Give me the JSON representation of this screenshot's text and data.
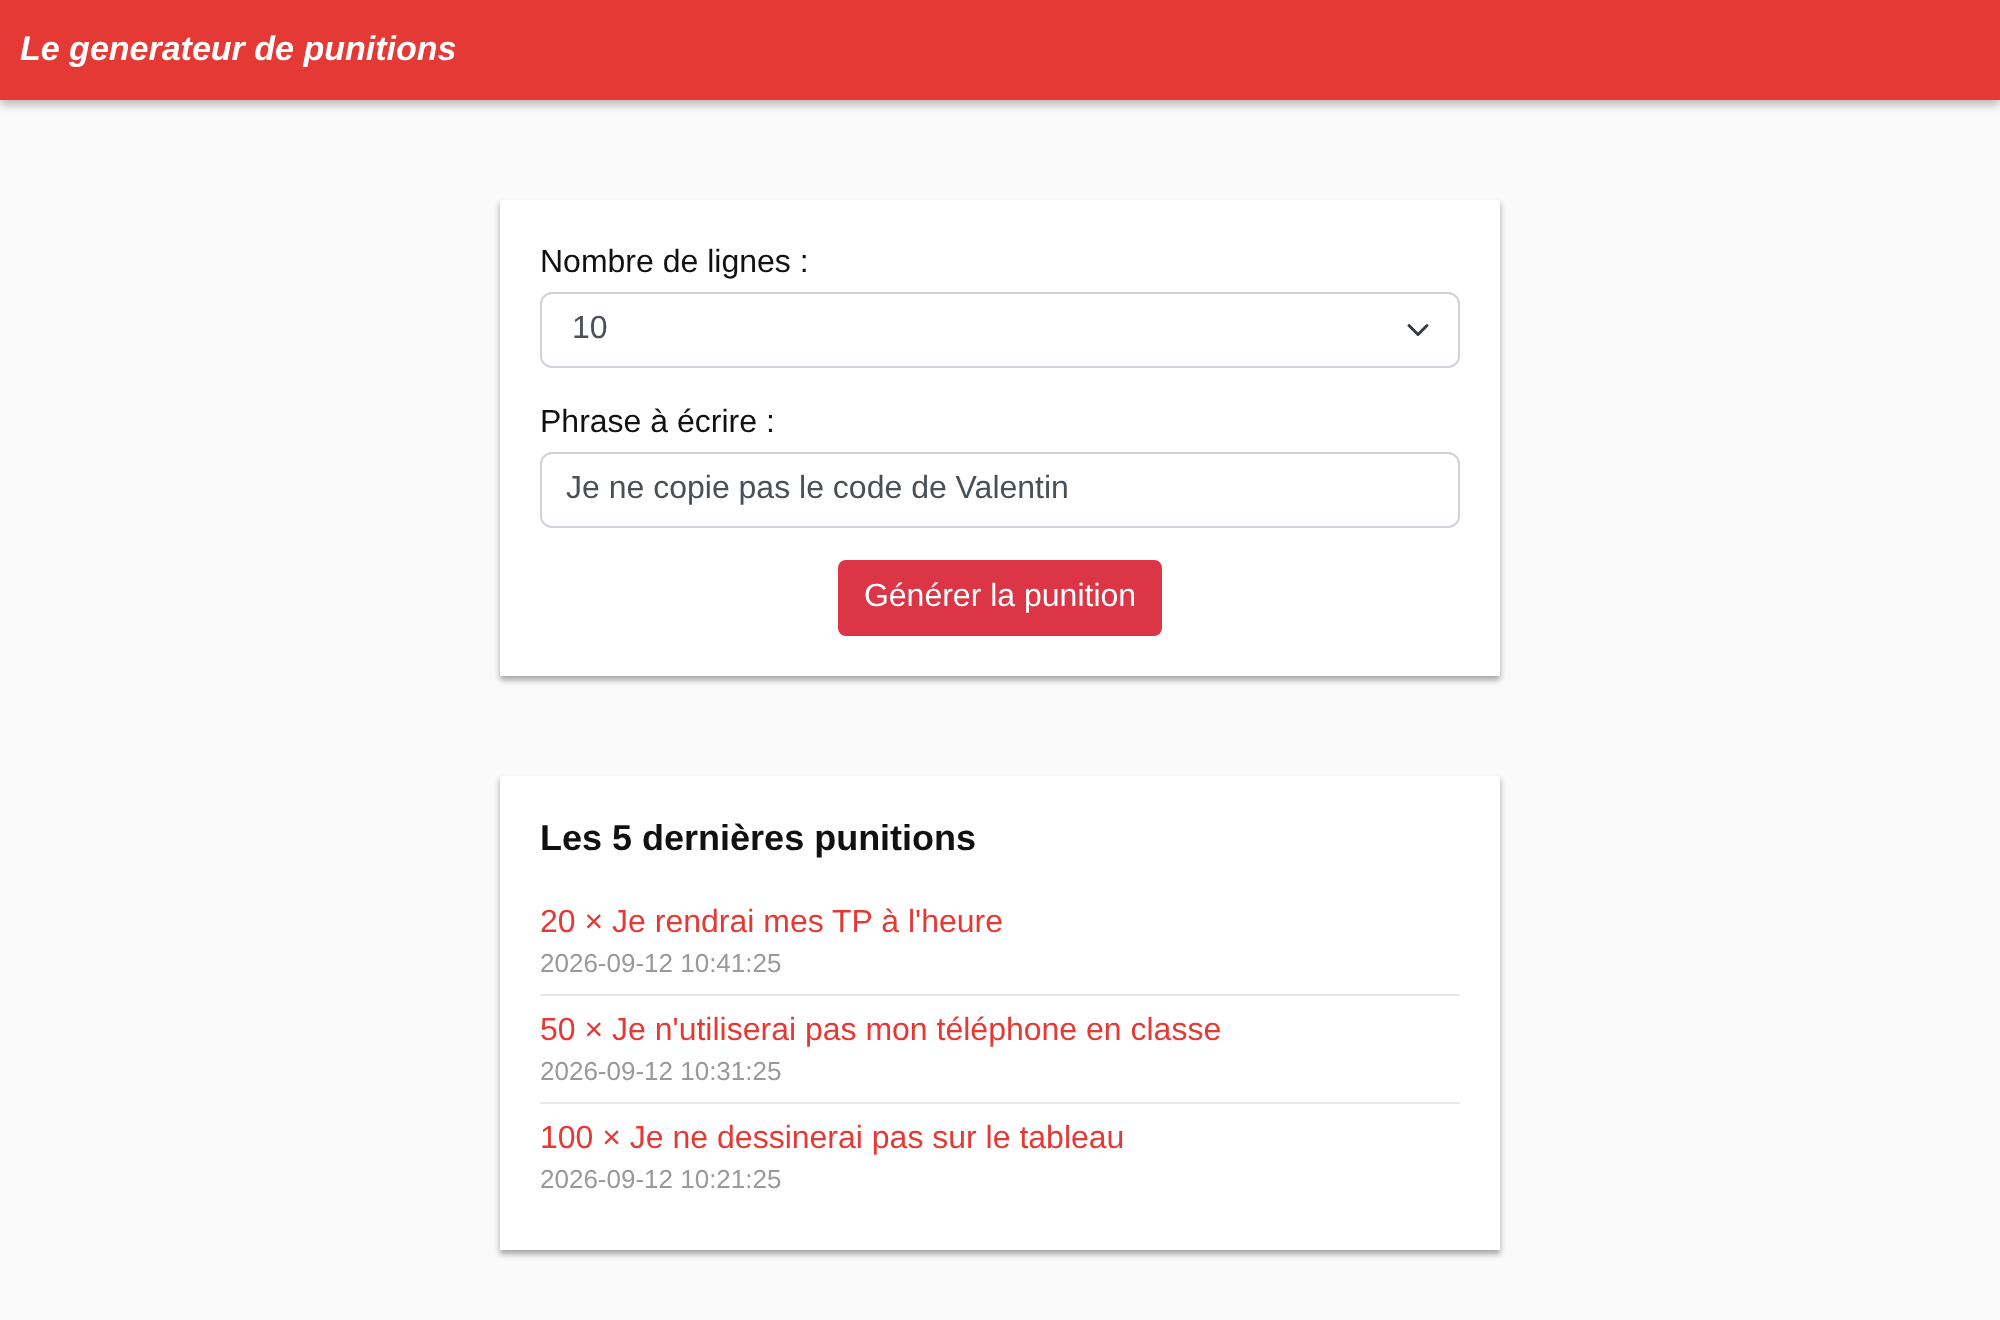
{
  "navbar": {
    "brand": "Le generateur de punitions"
  },
  "form": {
    "lines_label": "Nombre de lignes :",
    "lines_select": {
      "value": "10"
    },
    "phrase_label": "Phrase à écrire :",
    "phrase_input": {
      "value": "Je ne copie pas le code de Valentin"
    },
    "submit_button": "Générer la punition"
  },
  "history": {
    "title": "Les 5 dernières punitions",
    "items": [
      {
        "text": "20 × Je rendrai mes TP à l'heure",
        "date": "2026-09-12 10:41:25"
      },
      {
        "text": "50 × Je n'utiliserai pas mon téléphone en classe",
        "date": "2026-09-12 10:31:25"
      },
      {
        "text": "100 × Je ne dessinerai pas sur le tableau",
        "date": "2026-09-12 10:21:25"
      }
    ]
  }
}
